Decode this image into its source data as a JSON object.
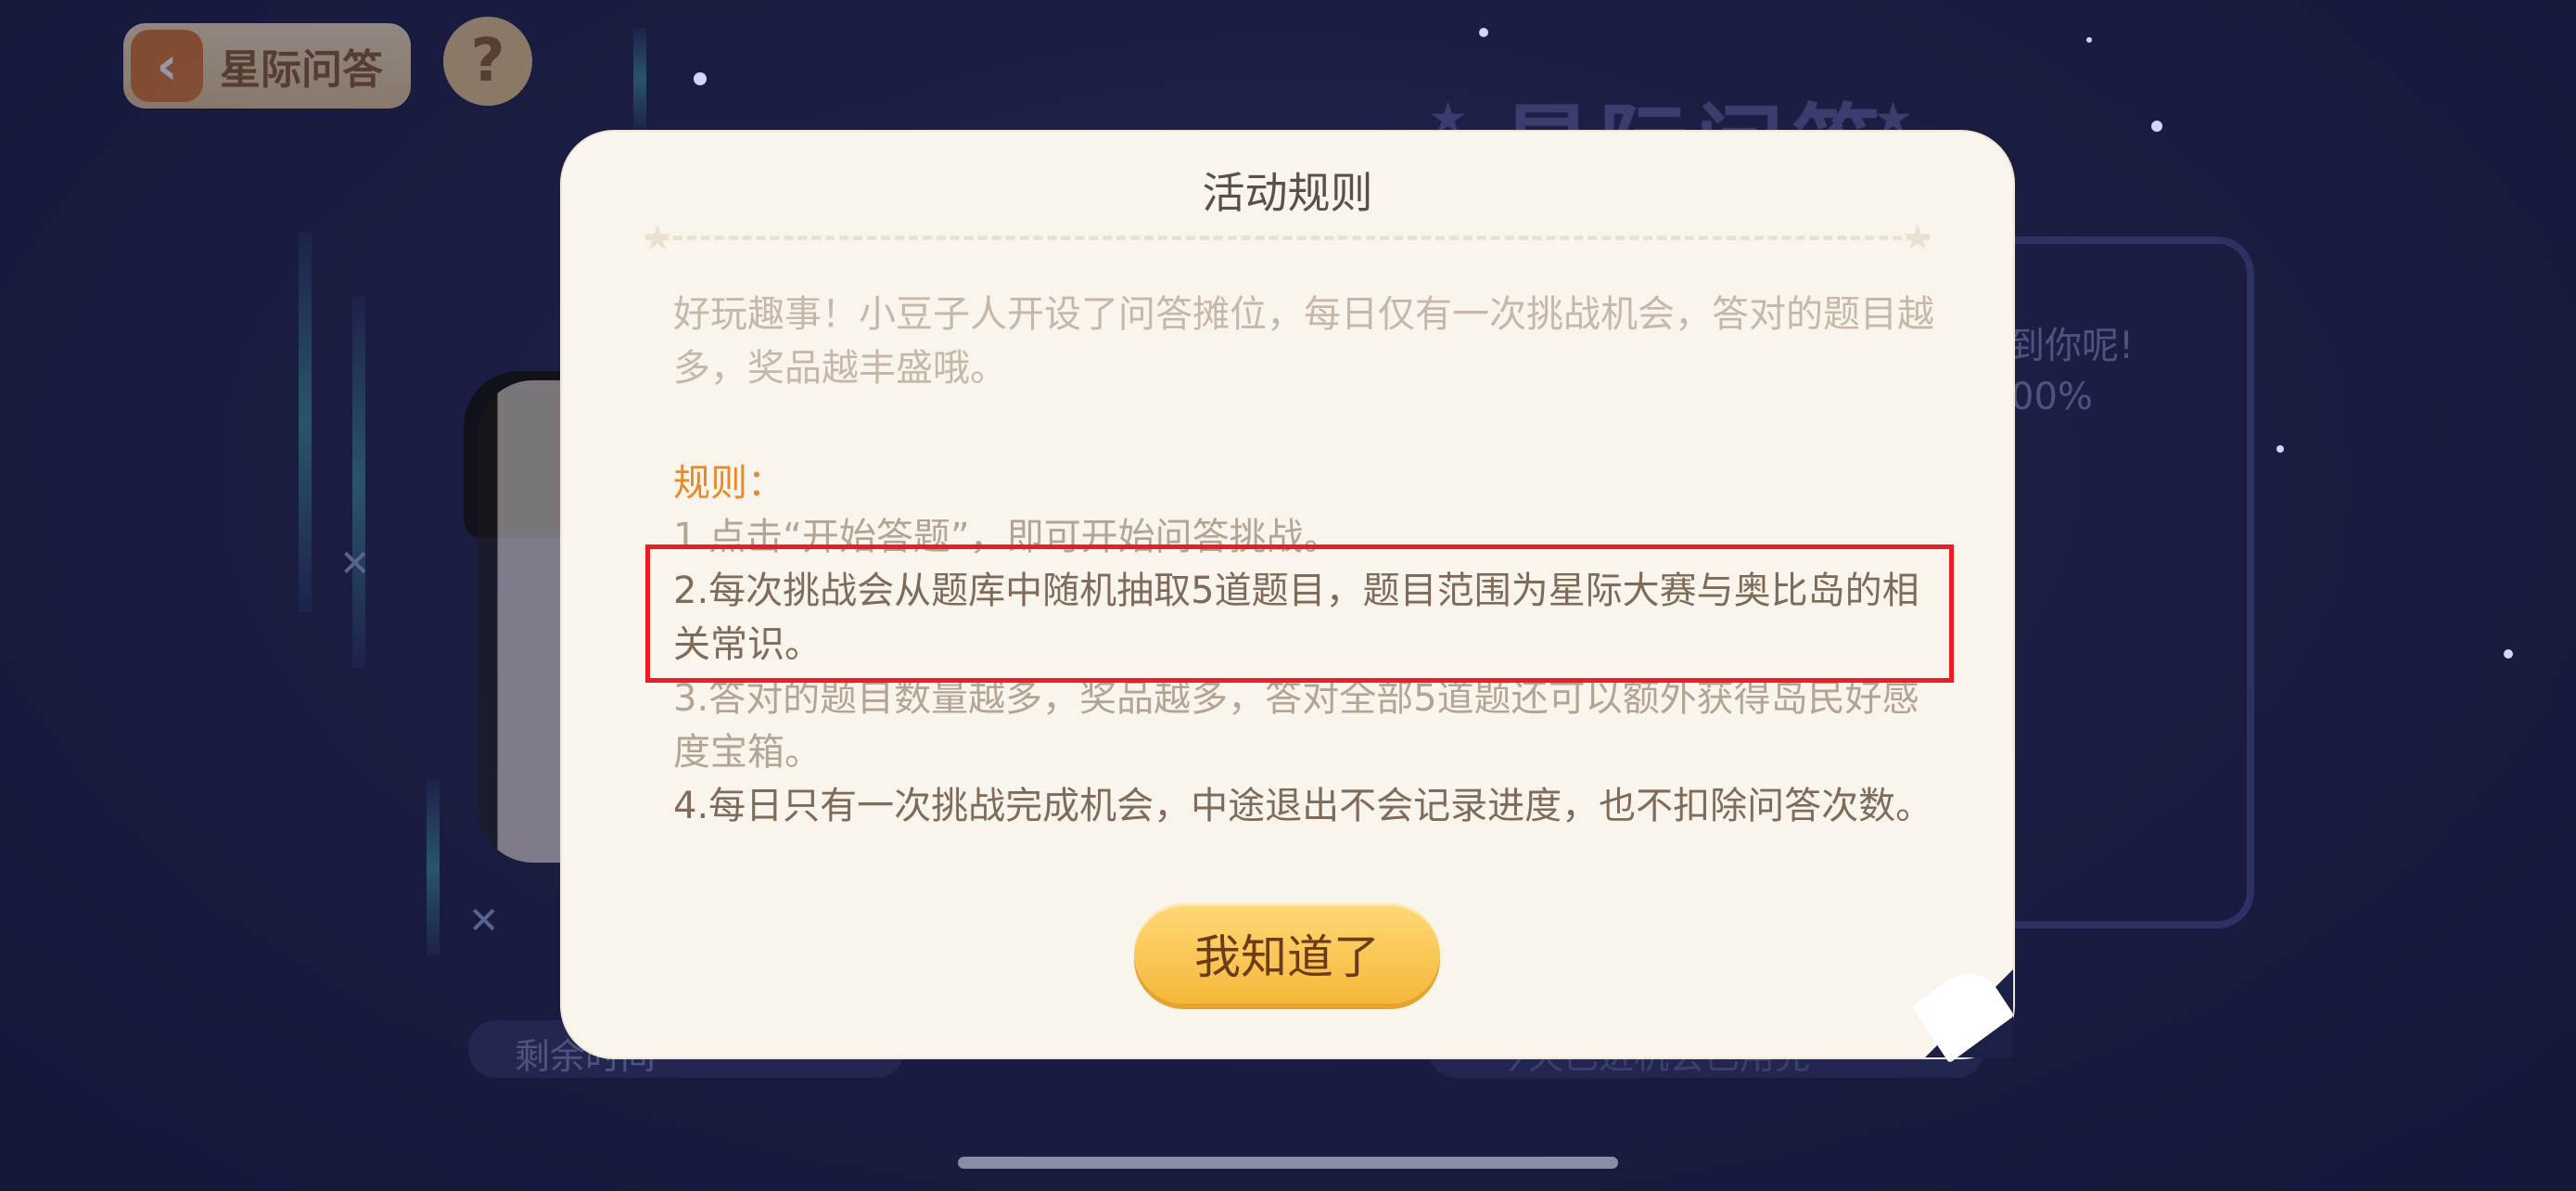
{
  "background": {
    "scene_title": "星际问答",
    "panel_text_1": "到你呢!",
    "panel_text_2": "00%",
    "bottom_left_text": "剩余时间",
    "bottom_right_text": "今天已进机会已用完"
  },
  "top_bar": {
    "back_label": "星际问答",
    "back_icon": "chevron-left-icon",
    "help_glyph": "?"
  },
  "dialog": {
    "title": "活动规则",
    "intro": "好玩趣事！小豆子人开设了问答摊位，每日仅有一次挑战机会，答对的题目越多，奖品越丰盛哦。",
    "rules_heading": "规则：",
    "rules": [
      "1.点击“开始答题”，即可开始问答挑战。",
      "2.每次挑战会从题库中随机抽取5道题目，题目范围为星际大赛与奥比岛的相关常识。",
      "3.答对的题目数量越多，奖品越多，答对全部5道题还可以额外获得岛民好感度宝箱。",
      "4.每日只有一次挑战完成机会，中途退出不会记录进度，也不扣除问答次数。"
    ],
    "confirm_label": "我知道了"
  },
  "colors": {
    "highlight": "#ee1a24",
    "rules_heading": "#e8892b",
    "button": "#f6b83a"
  }
}
